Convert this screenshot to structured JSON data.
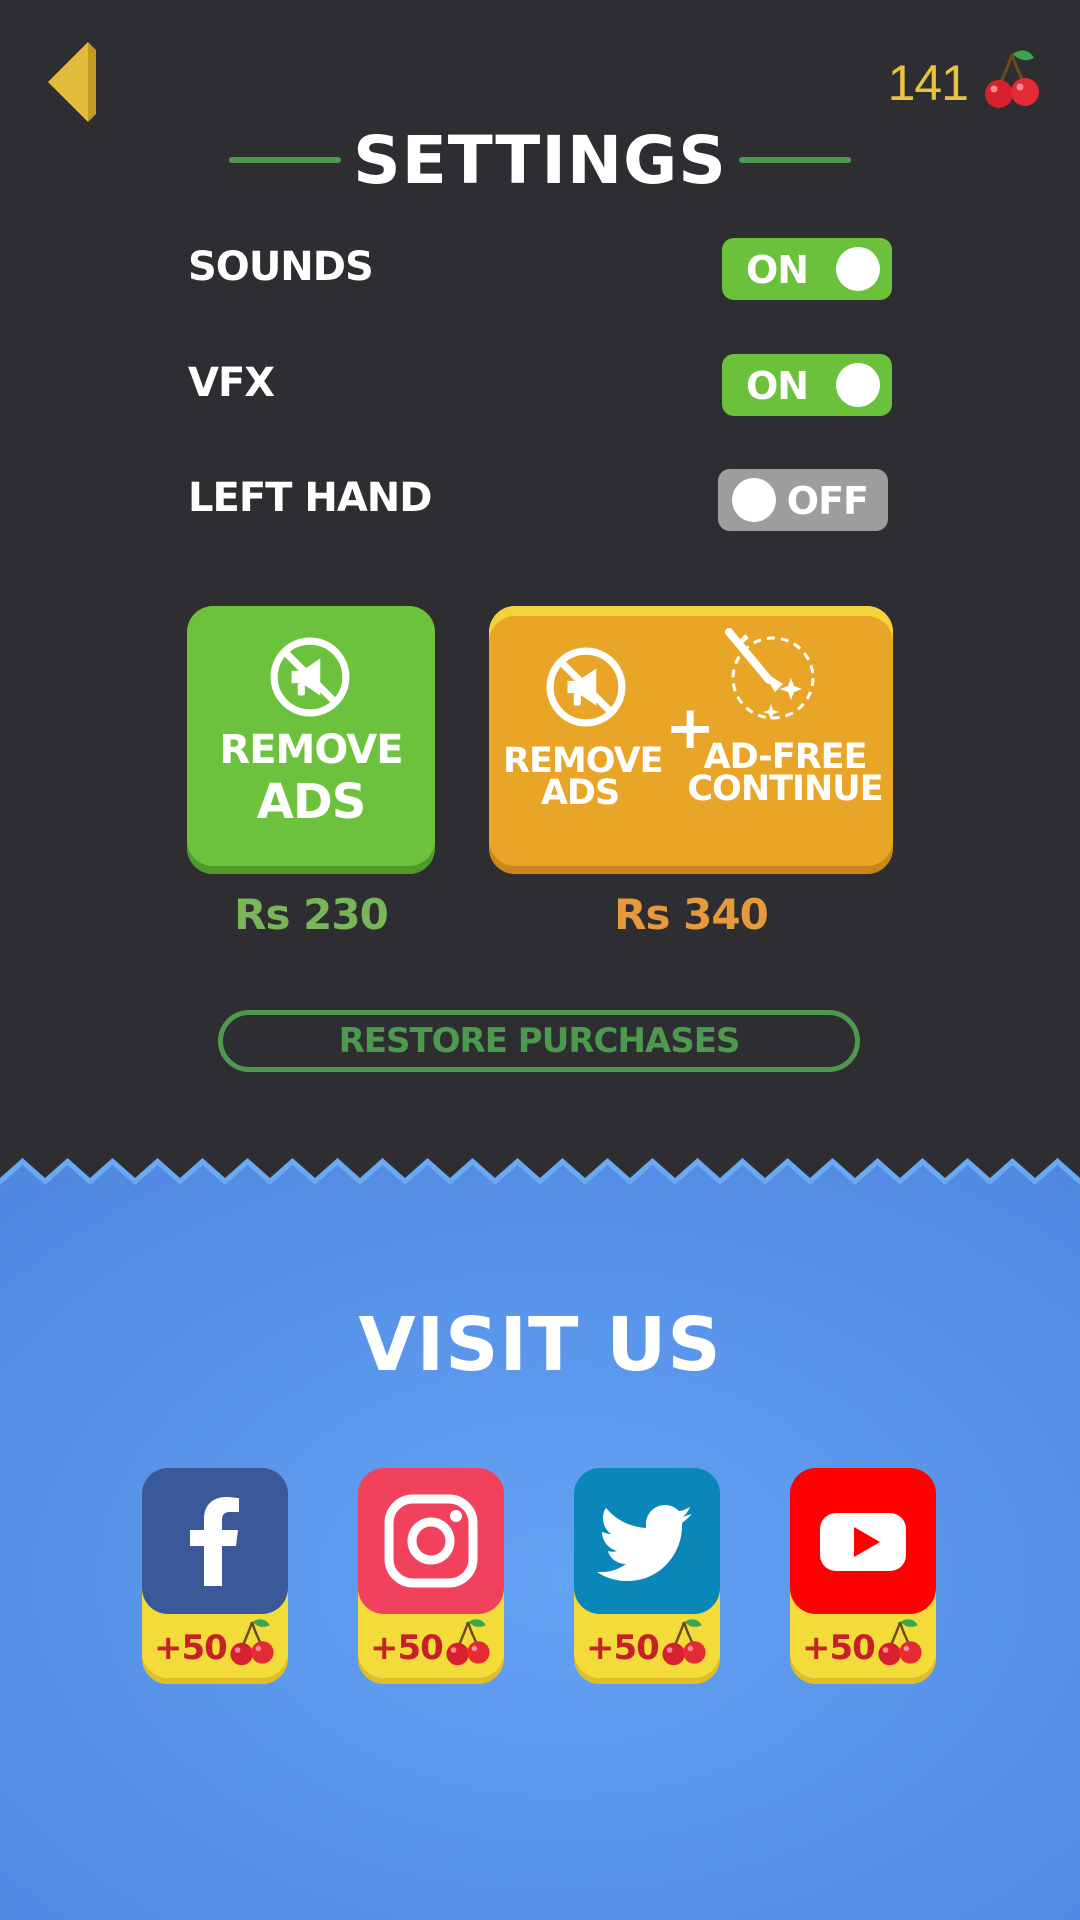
{
  "header": {
    "cherry_count": "141",
    "back_icon": "back-triangle-icon",
    "currency_icon": "cherry-icon"
  },
  "settings": {
    "title": "SETTINGS",
    "rows": [
      {
        "label": "SOUNDS",
        "state": "ON"
      },
      {
        "label": "VFX",
        "state": "ON"
      },
      {
        "label": "LEFT HAND",
        "state": "OFF"
      }
    ]
  },
  "purchases": {
    "remove_ads": {
      "line1": "REMOVE",
      "line2": "ADS",
      "price": "Rs 230",
      "icon": "no-ads-megaphone-icon"
    },
    "bundle": {
      "left_line1": "REMOVE",
      "left_line2": "ADS",
      "plus": "+",
      "right_line1": "AD-FREE",
      "right_line2": "CONTINUE",
      "price": "Rs 340",
      "icons": [
        "no-ads-megaphone-icon",
        "sword-sparkle-icon"
      ]
    },
    "restore_label": "RESTORE PURCHASES"
  },
  "visit": {
    "title": "VISIT US",
    "socials": [
      {
        "name": "facebook",
        "reward": "+50",
        "color": "#3b5998"
      },
      {
        "name": "instagram",
        "reward": "+50",
        "color": "#f2415d"
      },
      {
        "name": "twitter",
        "reward": "+50",
        "color": "#0b86b9"
      },
      {
        "name": "youtube",
        "reward": "+50",
        "color": "#ff0000"
      }
    ]
  },
  "colors": {
    "background_dark": "#2e2d31",
    "accent_green": "#6bc13b",
    "accent_orange": "#e9a528",
    "price_green": "#79b65a",
    "price_orange": "#e59a3b",
    "toggle_off": "#9d9d9d",
    "bottom_blue": "#5e9af0",
    "gold": "#e8c33f"
  }
}
